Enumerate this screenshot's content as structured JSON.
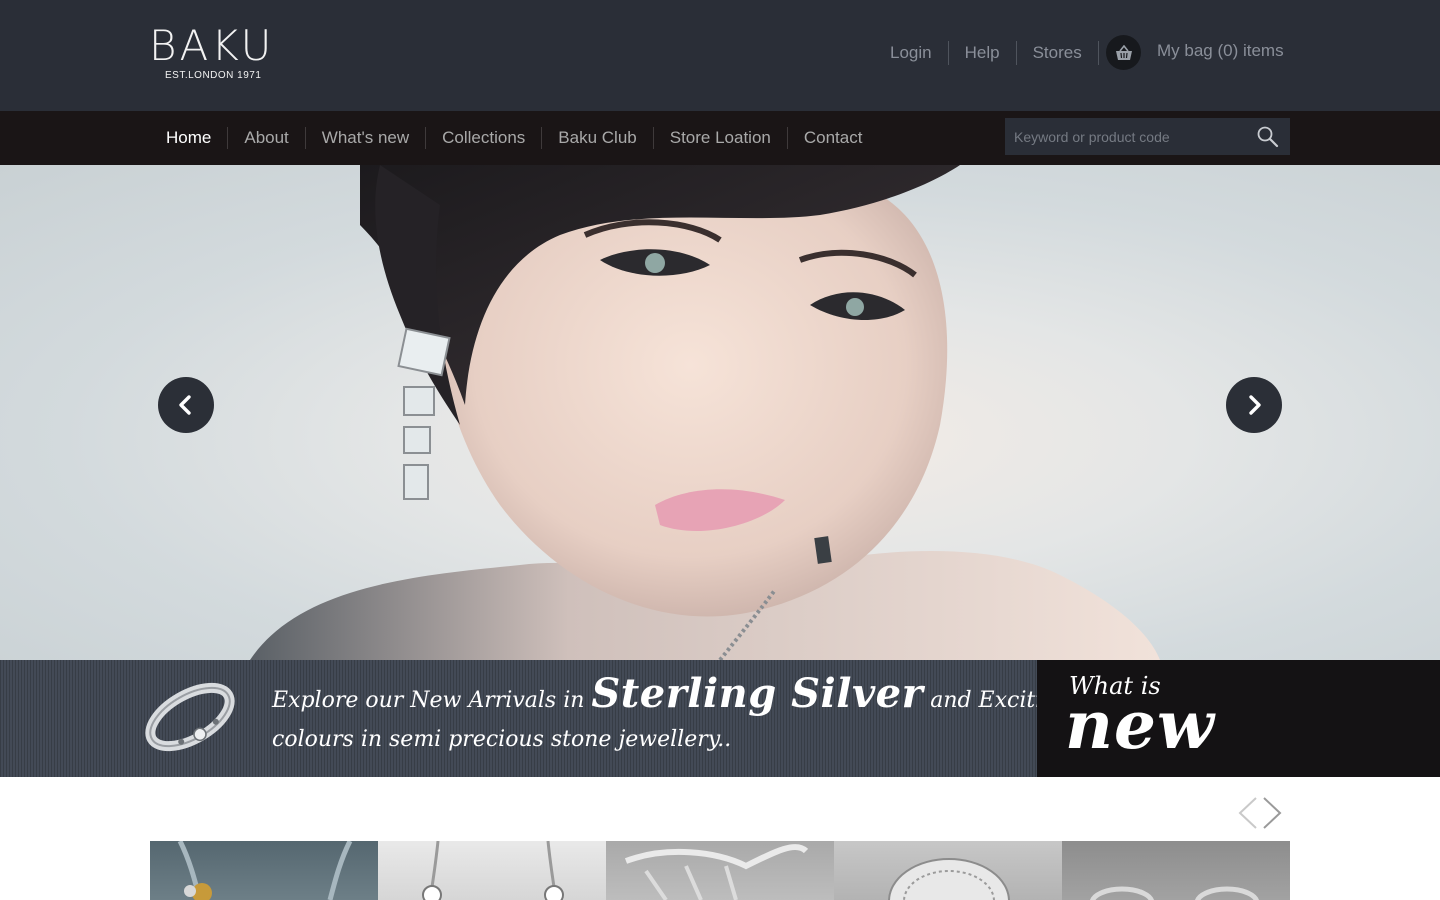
{
  "brand": {
    "name": "BAKU",
    "tagline": "EST.LONDON 1971"
  },
  "utility_nav": {
    "links": [
      "Login",
      "Help",
      "Stores"
    ],
    "bag_label": "My bag (0) items",
    "bag_icon": "basket-icon"
  },
  "main_nav": {
    "items": [
      "Home",
      "About",
      "What's new",
      "Collections",
      "Baku Club",
      "Store Loation",
      "Contact"
    ],
    "active": "Home"
  },
  "search": {
    "placeholder": "Keyword or product code",
    "icon": "search-icon"
  },
  "hero": {
    "prev_icon": "chevron-left-icon",
    "next_icon": "chevron-right-icon"
  },
  "banner": {
    "line1_prefix": "Explore our New Arrivals in ",
    "line1_highlight": "Sterling Silver",
    "line1_suffix": " and Exciting new",
    "line2": "colours in semi precious stone jewellery..",
    "whats_new_small": "What is",
    "whats_new_big": "new"
  },
  "products": {
    "count": 5,
    "prev_icon": "chevron-left-icon",
    "next_icon": "chevron-right-icon"
  },
  "colors": {
    "header_bg": "#2a2e37",
    "nav_bg": "#1a1516",
    "banner_bg": "#434a56",
    "whats_new_bg": "#141214",
    "text_muted": "#8a8f99"
  }
}
